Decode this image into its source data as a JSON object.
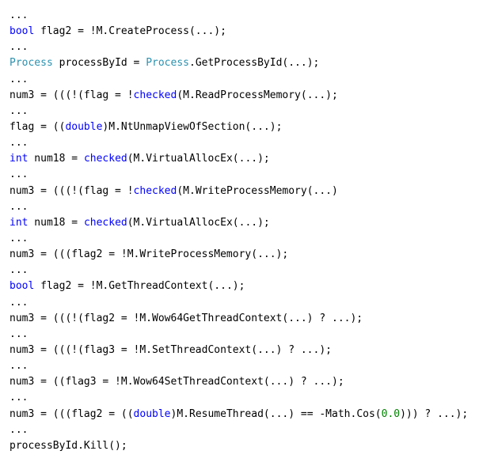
{
  "code": {
    "tokens": [
      {
        "cls": "",
        "text": "..."
      },
      {
        "cls": "",
        "text": "\n"
      },
      {
        "cls": "kw",
        "text": "bool"
      },
      {
        "cls": "",
        "text": " flag2 = !M.CreateProcess(...);"
      },
      {
        "cls": "",
        "text": "\n"
      },
      {
        "cls": "",
        "text": "..."
      },
      {
        "cls": "",
        "text": "\n"
      },
      {
        "cls": "typ",
        "text": "Process"
      },
      {
        "cls": "",
        "text": " processById = "
      },
      {
        "cls": "typ",
        "text": "Process"
      },
      {
        "cls": "",
        "text": ".GetProcessById(...);"
      },
      {
        "cls": "",
        "text": "\n"
      },
      {
        "cls": "",
        "text": "..."
      },
      {
        "cls": "",
        "text": "\n"
      },
      {
        "cls": "",
        "text": "num3 = (((!(flag = !"
      },
      {
        "cls": "fn",
        "text": "checked"
      },
      {
        "cls": "",
        "text": "(M.ReadProcessMemory(...);"
      },
      {
        "cls": "",
        "text": "\n"
      },
      {
        "cls": "",
        "text": "..."
      },
      {
        "cls": "",
        "text": "\n"
      },
      {
        "cls": "",
        "text": "flag = (("
      },
      {
        "cls": "kw",
        "text": "double"
      },
      {
        "cls": "",
        "text": ")M.NtUnmapViewOfSection(...);"
      },
      {
        "cls": "",
        "text": "\n"
      },
      {
        "cls": "",
        "text": "..."
      },
      {
        "cls": "",
        "text": "\n"
      },
      {
        "cls": "kw",
        "text": "int"
      },
      {
        "cls": "",
        "text": " num18 = "
      },
      {
        "cls": "fn",
        "text": "checked"
      },
      {
        "cls": "",
        "text": "(M.VirtualAllocEx(...);"
      },
      {
        "cls": "",
        "text": "\n"
      },
      {
        "cls": "",
        "text": "..."
      },
      {
        "cls": "",
        "text": "\n"
      },
      {
        "cls": "",
        "text": "num3 = (((!(flag = !"
      },
      {
        "cls": "fn",
        "text": "checked"
      },
      {
        "cls": "",
        "text": "(M.WriteProcessMemory(...)"
      },
      {
        "cls": "",
        "text": "\n"
      },
      {
        "cls": "",
        "text": "..."
      },
      {
        "cls": "",
        "text": "\n"
      },
      {
        "cls": "kw",
        "text": "int"
      },
      {
        "cls": "",
        "text": " num18 = "
      },
      {
        "cls": "fn",
        "text": "checked"
      },
      {
        "cls": "",
        "text": "(M.VirtualAllocEx(...);"
      },
      {
        "cls": "",
        "text": "\n"
      },
      {
        "cls": "",
        "text": "..."
      },
      {
        "cls": "",
        "text": "\n"
      },
      {
        "cls": "",
        "text": "num3 = (((flag2 = !M.WriteProcessMemory(...);"
      },
      {
        "cls": "",
        "text": "\n"
      },
      {
        "cls": "",
        "text": "..."
      },
      {
        "cls": "",
        "text": "\n"
      },
      {
        "cls": "kw",
        "text": "bool"
      },
      {
        "cls": "",
        "text": " flag2 = !M.GetThreadContext(...);"
      },
      {
        "cls": "",
        "text": "\n"
      },
      {
        "cls": "",
        "text": "..."
      },
      {
        "cls": "",
        "text": "\n"
      },
      {
        "cls": "",
        "text": "num3 = (((!(flag2 = !M.Wow64GetThreadContext(...) ? ...);"
      },
      {
        "cls": "",
        "text": "\n"
      },
      {
        "cls": "",
        "text": "..."
      },
      {
        "cls": "",
        "text": "\n"
      },
      {
        "cls": "",
        "text": "num3 = (((!(flag3 = !M.SetThreadContext(...) ? ...);"
      },
      {
        "cls": "",
        "text": "\n"
      },
      {
        "cls": "",
        "text": "..."
      },
      {
        "cls": "",
        "text": "\n"
      },
      {
        "cls": "",
        "text": "num3 = ((flag3 = !M.Wow64SetThreadContext(...) ? ...);"
      },
      {
        "cls": "",
        "text": "\n"
      },
      {
        "cls": "",
        "text": "..."
      },
      {
        "cls": "",
        "text": "\n"
      },
      {
        "cls": "",
        "text": "num3 = (((flag2 = (("
      },
      {
        "cls": "kw",
        "text": "double"
      },
      {
        "cls": "",
        "text": ")M.ResumeThread(...) == -Math.Cos("
      },
      {
        "cls": "num",
        "text": "0.0"
      },
      {
        "cls": "",
        "text": "))) ? ...);"
      },
      {
        "cls": "",
        "text": "\n"
      },
      {
        "cls": "",
        "text": "..."
      },
      {
        "cls": "",
        "text": "\n"
      },
      {
        "cls": "",
        "text": "processById.Kill();"
      }
    ]
  }
}
